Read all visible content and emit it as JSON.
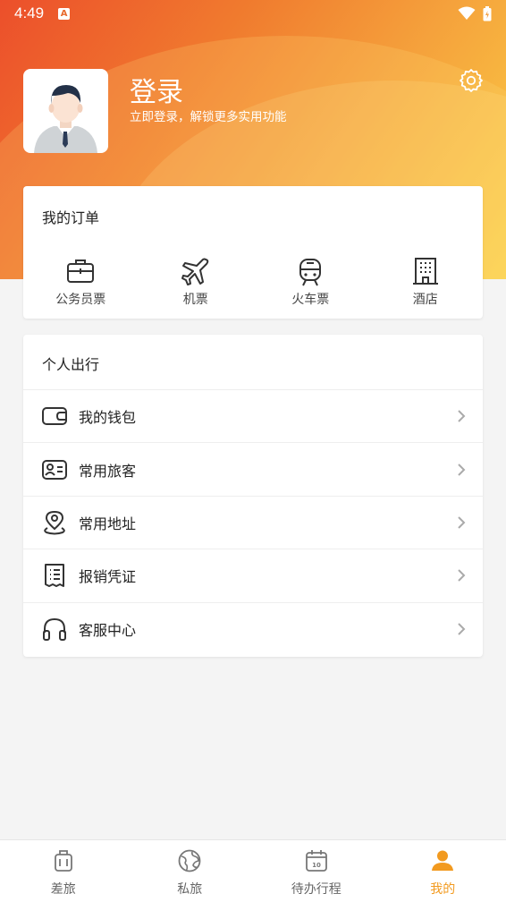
{
  "status_bar": {
    "time": "4:49",
    "notification_icon": "A"
  },
  "header": {
    "title": "登录",
    "subtitle": "立即登录，解锁更多实用功能"
  },
  "orders": {
    "title": "我的订单",
    "items": [
      {
        "label": "公务员票",
        "icon": "briefcase-icon"
      },
      {
        "label": "机票",
        "icon": "airplane-icon"
      },
      {
        "label": "火车票",
        "icon": "train-icon"
      },
      {
        "label": "酒店",
        "icon": "hotel-icon"
      }
    ]
  },
  "personal": {
    "title": "个人出行",
    "items": [
      {
        "label": "我的钱包",
        "icon": "wallet-icon"
      },
      {
        "label": "常用旅客",
        "icon": "id-card-icon"
      },
      {
        "label": "常用地址",
        "icon": "location-icon"
      },
      {
        "label": "报销凭证",
        "icon": "receipt-icon"
      },
      {
        "label": "客服中心",
        "icon": "headset-icon"
      }
    ]
  },
  "tabs": [
    {
      "label": "差旅",
      "icon": "luggage-icon",
      "active": false
    },
    {
      "label": "私旅",
      "icon": "globe-icon",
      "active": false
    },
    {
      "label": "待办行程",
      "icon": "calendar-icon",
      "active": false,
      "badge": "10"
    },
    {
      "label": "我的",
      "icon": "person-icon",
      "active": true
    }
  ],
  "colors": {
    "accent": "#f29a1f",
    "gradient_start": "#ec4f2b",
    "gradient_end": "#fbd045"
  }
}
